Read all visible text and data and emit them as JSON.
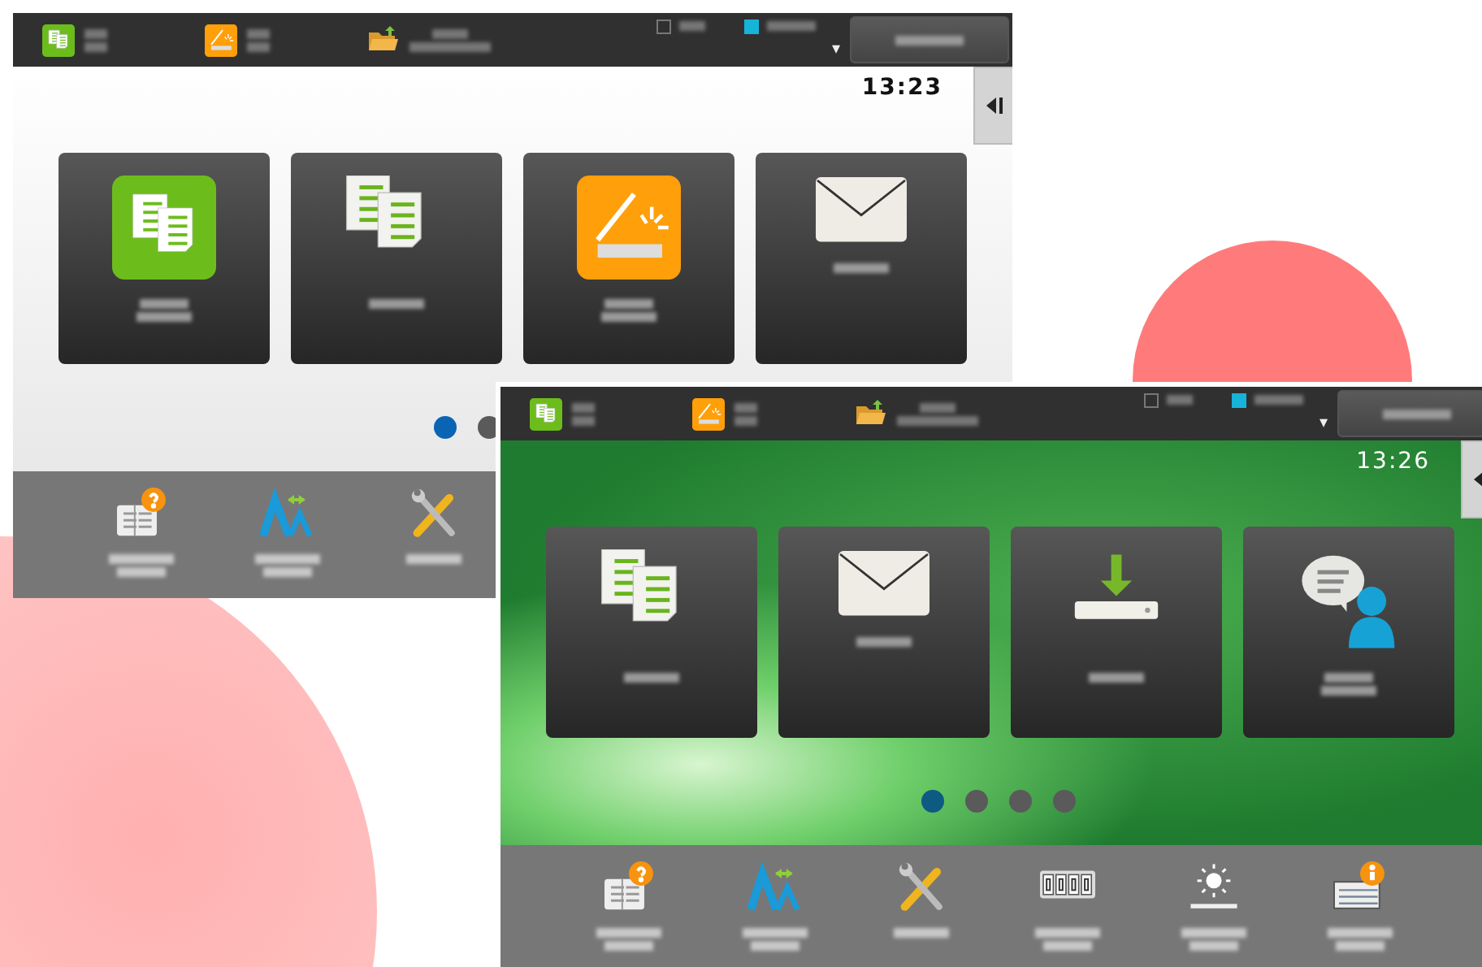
{
  "screens": [
    {
      "background": {
        "kind": "plain"
      },
      "shortcuts": [
        {
          "kind": "easy-copy"
        },
        {
          "kind": "easy-scan"
        },
        {
          "kind": "folder"
        }
      ],
      "indicators": [
        {
          "kind": "outline"
        },
        {
          "kind": "filled",
          "color": "#16b4d8"
        }
      ],
      "menu_arrow": "▾",
      "clock": "13:23",
      "tiles": [
        {
          "kind": "easy-copy"
        },
        {
          "kind": "copy"
        },
        {
          "kind": "easy-scan"
        },
        {
          "kind": "email"
        }
      ],
      "dots": [
        {
          "selected": true
        },
        {
          "selected": false
        }
      ],
      "tools": [
        {
          "kind": "guide"
        },
        {
          "kind": "display-size"
        },
        {
          "kind": "tools"
        }
      ]
    },
    {
      "background": {
        "kind": "photo"
      },
      "shortcuts": [
        {
          "kind": "easy-copy"
        },
        {
          "kind": "easy-scan"
        },
        {
          "kind": "folder"
        }
      ],
      "indicators": [
        {
          "kind": "outline"
        },
        {
          "kind": "filled",
          "color": "#16b4d8"
        }
      ],
      "menu_arrow": "▾",
      "clock": "13:26",
      "tiles": [
        {
          "kind": "copy"
        },
        {
          "kind": "email"
        },
        {
          "kind": "scan-usb"
        },
        {
          "kind": "language"
        }
      ],
      "dots": [
        {
          "selected": true
        },
        {
          "selected": false
        },
        {
          "selected": false
        },
        {
          "selected": false
        }
      ],
      "tools": [
        {
          "kind": "guide"
        },
        {
          "kind": "display-size"
        },
        {
          "kind": "tools"
        },
        {
          "kind": "counter"
        },
        {
          "kind": "brightness"
        },
        {
          "kind": "info"
        }
      ]
    }
  ]
}
